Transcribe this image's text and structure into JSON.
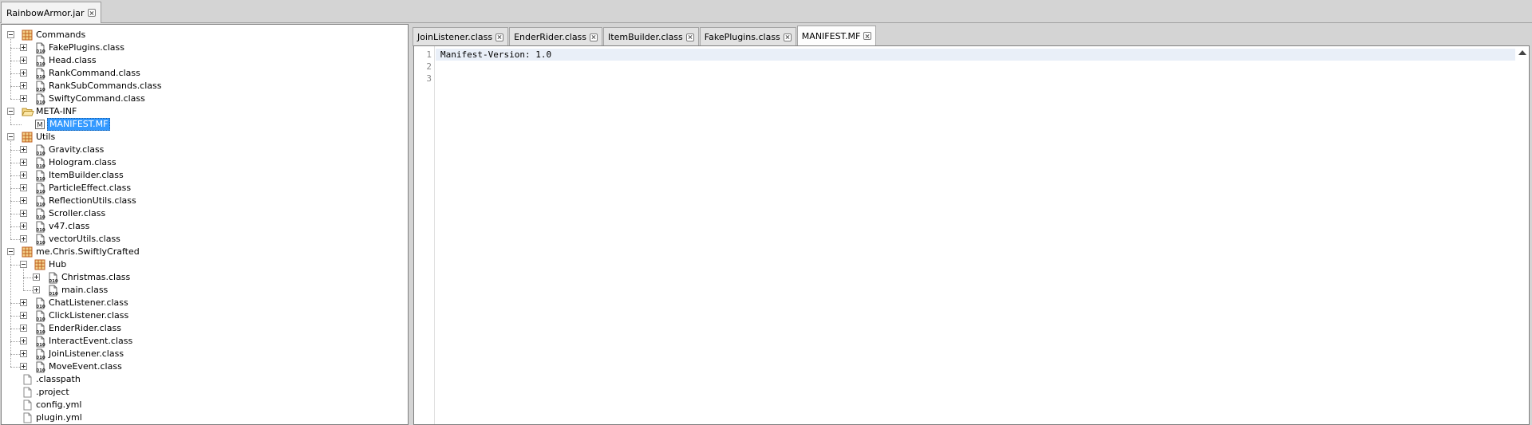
{
  "window": {
    "file_tab_label": "RainbowArmor.jar"
  },
  "tree": [
    {
      "label": "Commands",
      "icon": "package-icon",
      "depth": 0,
      "expander": "minus"
    },
    {
      "label": "FakePlugins.class",
      "icon": "class-file-icon",
      "depth": 1,
      "expander": "plus"
    },
    {
      "label": "Head.class",
      "icon": "class-file-icon",
      "depth": 1,
      "expander": "plus"
    },
    {
      "label": "RankCommand.class",
      "icon": "class-file-icon",
      "depth": 1,
      "expander": "plus"
    },
    {
      "label": "RankSubCommands.class",
      "icon": "class-file-icon",
      "depth": 1,
      "expander": "plus"
    },
    {
      "label": "SwiftyCommand.class",
      "icon": "class-file-icon",
      "depth": 1,
      "expander": "plus"
    },
    {
      "label": "META-INF",
      "icon": "folder-open-icon",
      "depth": 0,
      "expander": "minus"
    },
    {
      "label": "MANIFEST.MF",
      "icon": "manifest-file-icon",
      "depth": 1,
      "expander": "none",
      "selected": true
    },
    {
      "label": "Utils",
      "icon": "package-icon",
      "depth": 0,
      "expander": "minus"
    },
    {
      "label": "Gravity.class",
      "icon": "class-file-icon",
      "depth": 1,
      "expander": "plus"
    },
    {
      "label": "Hologram.class",
      "icon": "class-file-icon",
      "depth": 1,
      "expander": "plus"
    },
    {
      "label": "ItemBuilder.class",
      "icon": "class-file-icon",
      "depth": 1,
      "expander": "plus"
    },
    {
      "label": "ParticleEffect.class",
      "icon": "class-file-icon",
      "depth": 1,
      "expander": "plus"
    },
    {
      "label": "ReflectionUtils.class",
      "icon": "class-file-icon",
      "depth": 1,
      "expander": "plus"
    },
    {
      "label": "Scroller.class",
      "icon": "class-file-icon",
      "depth": 1,
      "expander": "plus"
    },
    {
      "label": "v47.class",
      "icon": "class-file-icon",
      "depth": 1,
      "expander": "plus"
    },
    {
      "label": "vectorUtils.class",
      "icon": "class-file-icon",
      "depth": 1,
      "expander": "plus"
    },
    {
      "label": "me.Chris.SwiftlyCrafted",
      "icon": "package-icon",
      "depth": 0,
      "expander": "minus"
    },
    {
      "label": "Hub",
      "icon": "package-icon",
      "depth": 1,
      "expander": "minus"
    },
    {
      "label": "Christmas.class",
      "icon": "class-file-icon",
      "depth": 2,
      "expander": "plus"
    },
    {
      "label": "main.class",
      "icon": "class-file-icon",
      "depth": 2,
      "expander": "plus"
    },
    {
      "label": "ChatListener.class",
      "icon": "class-file-icon",
      "depth": 1,
      "expander": "plus"
    },
    {
      "label": "ClickListener.class",
      "icon": "class-file-icon",
      "depth": 1,
      "expander": "plus"
    },
    {
      "label": "EnderRider.class",
      "icon": "class-file-icon",
      "depth": 1,
      "expander": "plus"
    },
    {
      "label": "InteractEvent.class",
      "icon": "class-file-icon",
      "depth": 1,
      "expander": "plus"
    },
    {
      "label": "JoinListener.class",
      "icon": "class-file-icon",
      "depth": 1,
      "expander": "plus"
    },
    {
      "label": "MoveEvent.class",
      "icon": "class-file-icon",
      "depth": 1,
      "expander": "plus"
    },
    {
      "label": ".classpath",
      "icon": "text-file-icon",
      "depth": 0,
      "expander": "none"
    },
    {
      "label": ".project",
      "icon": "text-file-icon",
      "depth": 0,
      "expander": "none"
    },
    {
      "label": "config.yml",
      "icon": "text-file-icon",
      "depth": 0,
      "expander": "none"
    },
    {
      "label": "plugin.yml",
      "icon": "text-file-icon",
      "depth": 0,
      "expander": "none"
    }
  ],
  "editor_tabs": [
    {
      "label": "JoinListener.class",
      "active": false
    },
    {
      "label": "EnderRider.class",
      "active": false
    },
    {
      "label": "ItemBuilder.class",
      "active": false
    },
    {
      "label": "FakePlugins.class",
      "active": false
    },
    {
      "label": "MANIFEST.MF",
      "active": true
    }
  ],
  "editor": {
    "line_numbers": [
      "1",
      "2",
      "3"
    ],
    "lines": [
      "Manifest-Version: 1.0",
      "",
      ""
    ]
  },
  "colors": {
    "selection": "#3399ff",
    "package": "#c06020",
    "class_file": "#2a2a2a"
  }
}
